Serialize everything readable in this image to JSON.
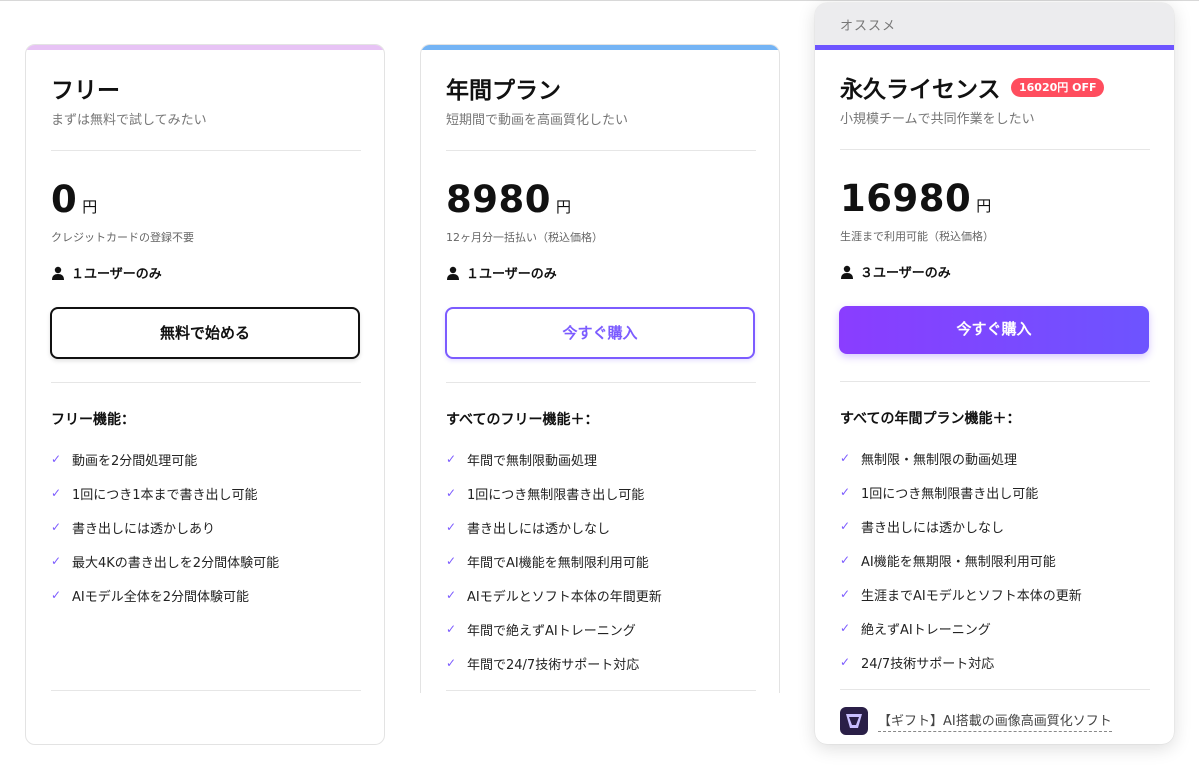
{
  "recommend_label": "オススメ",
  "colors": {
    "free_bar": "#e7c3f5",
    "annual_bar": "#74b4f5",
    "perm_bar": "#6d54ff",
    "accent": "#7c5cff",
    "badge": "#ff4d5e"
  },
  "plans": [
    {
      "name": "フリー",
      "subtitle": "まずは無料で試してみたい",
      "price": "0",
      "currency": "円",
      "price_note": "クレジットカードの登録不要",
      "users": "１ユーザーのみ",
      "cta": "無料で始める",
      "features_title": "フリー機能：",
      "features": [
        "動画を2分間処理可能",
        "1回につき1本まで書き出し可能",
        "書き出しには透かしあり",
        "最大4Kの書き出しを2分間体験可能",
        "AIモデル全体を2分間体験可能"
      ]
    },
    {
      "name": "年間プラン",
      "subtitle": "短期間で動画を高画質化したい",
      "price": "8980",
      "currency": "円",
      "price_note": "12ヶ月分一括払い（税込価格）",
      "users": "１ユーザーのみ",
      "cta": "今すぐ購入",
      "features_title": "すべてのフリー機能＋：",
      "features": [
        "年間で無制限動画処理",
        "1回につき無制限書き出し可能",
        "書き出しには透かしなし",
        "年間でAI機能を無制限利用可能",
        "AIモデルとソフト本体の年間更新",
        "年間で絶えずAIトレーニング",
        "年間で24/7技術サポート対応"
      ]
    },
    {
      "name": "永久ライセンス",
      "badge": "16020円 OFF",
      "subtitle": "小規模チームで共同作業をしたい",
      "price": "16980",
      "currency": "円",
      "price_note": "生涯まで利用可能（税込価格）",
      "users": "３ユーザーのみ",
      "cta": "今すぐ購入",
      "features_title": "すべての年間プラン機能＋：",
      "features": [
        "無制限・無制限の動画処理",
        "1回につき無制限書き出し可能",
        "書き出しには透かしなし",
        "AI機能を無期限・無制限利用可能",
        "生涯までAIモデルとソフト本体の更新",
        "絶えずAIトレーニング",
        "24/7技術サポート対応"
      ],
      "gift": "【ギフト】AI搭載の画像高画質化ソフト"
    }
  ]
}
